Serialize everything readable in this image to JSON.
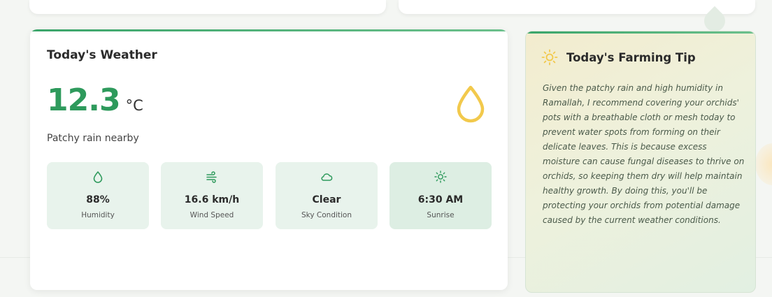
{
  "weather": {
    "title": "Today's Weather",
    "temperature": "12.3",
    "unit": "°C",
    "condition": "Patchy rain nearby",
    "main_icon": "droplet-icon",
    "stats": [
      {
        "icon": "droplet-icon",
        "value": "88%",
        "label": "Humidity"
      },
      {
        "icon": "wind-icon",
        "value": "16.6 km/h",
        "label": "Wind Speed"
      },
      {
        "icon": "cloud-icon",
        "value": "Clear",
        "label": "Sky Condition"
      },
      {
        "icon": "sun-icon",
        "value": "6:30 AM",
        "label": "Sunrise"
      }
    ]
  },
  "tip": {
    "icon": "sun-icon",
    "title": "Today's Farming Tip",
    "text": "Given the patchy rain and high humidity in Ramallah, I recommend covering your orchids' pots with a breathable cloth or mesh today to prevent water spots from forming on their delicate leaves. This is because excess moisture can cause fungal diseases to thrive on orchids, so keeping them dry will help maintain healthy growth. By doing this, you'll be protecting your orchids from potential damage caused by the current weather conditions."
  },
  "colors": {
    "accent_green": "#2e9a5c",
    "tile_bg": "#e8f3ec",
    "icon_yellow": "#f2c94c"
  }
}
